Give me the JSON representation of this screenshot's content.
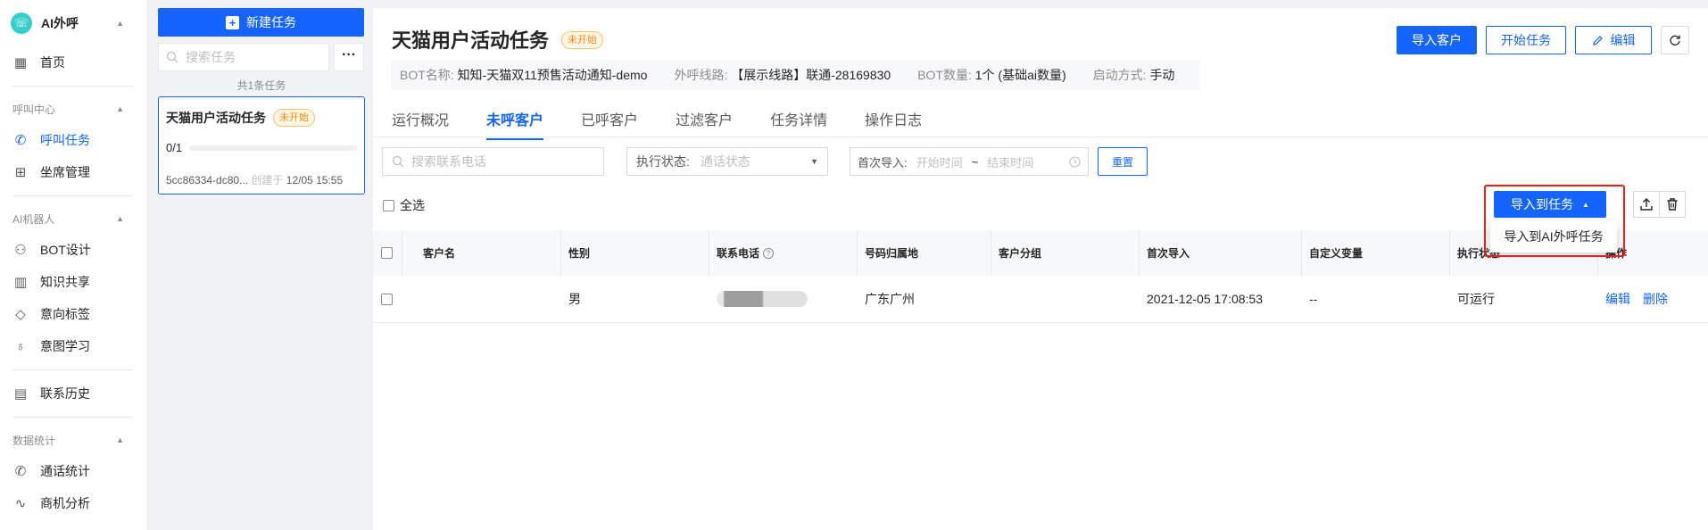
{
  "sidebar": {
    "brand": "AI外呼",
    "home": "首页",
    "groups": [
      {
        "label": "呼叫中心",
        "items": [
          "呼叫任务",
          "坐席管理"
        ]
      },
      {
        "label": "AI机器人",
        "items": [
          "BOT设计",
          "知识共享",
          "意向标签",
          "意图学习"
        ]
      }
    ],
    "history": "联系历史",
    "stats_group": "数据统计",
    "stats_items": [
      "通话统计",
      "商机分析"
    ]
  },
  "tasks": {
    "new_button": "新建任务",
    "search_placeholder": "搜索任务",
    "count": "共1条任务",
    "card": {
      "title": "天猫用户活动任务",
      "status": "未开始",
      "progress": "0/1",
      "progress_ratio": 0,
      "id": "5cc86334-dc80...",
      "created_label": "创建于",
      "created_time": "12/05 15:55"
    }
  },
  "main": {
    "title": "天猫用户活动任务",
    "status": "未开始",
    "info": {
      "bot_name_label": "BOT名称:",
      "bot_name": "知知-天猫双11预售活动通知-demo",
      "line_label": "外呼线路:",
      "line": "【展示线路】联通-28169830",
      "bot_count_label": "BOT数量:",
      "bot_count": "1个 (基础ai数量)",
      "start_label": "启动方式:",
      "start": "手动"
    },
    "buttons": {
      "import_customers": "导入客户",
      "start_task": "开始任务",
      "edit": "编辑"
    },
    "tabs": [
      "运行概况",
      "未呼客户",
      "已呼客户",
      "过滤客户",
      "任务详情",
      "操作日志"
    ],
    "active_tab": "未呼客户",
    "filters": {
      "search_placeholder": "搜索联系电话",
      "exec_label": "执行状态:",
      "exec_placeholder": "通话状态",
      "first_import_label": "首次导入:",
      "start_placeholder": "开始时间",
      "tilde": "~",
      "end_placeholder": "结束时间",
      "reset": "重置"
    },
    "select_all": "全选",
    "import_to_task": "导入到任务",
    "dropdown_item": "导入到AI外呼任务",
    "table": {
      "headers": [
        "客户名",
        "性别",
        "联系电话",
        "号码归属地",
        "客户分组",
        "首次导入",
        "自定义变量",
        "执行状态",
        "操作"
      ],
      "row": {
        "name": "",
        "gender": "男",
        "location": "广东广州",
        "group": "",
        "first_import": "2021-12-05 17:08:53",
        "custom_var": "--",
        "exec_status": "可运行",
        "actions": [
          "编辑",
          "删除"
        ]
      }
    }
  },
  "colors": {
    "primary": "#1664ff",
    "warning": "#fa8c16",
    "highlight": "#e8221b"
  }
}
